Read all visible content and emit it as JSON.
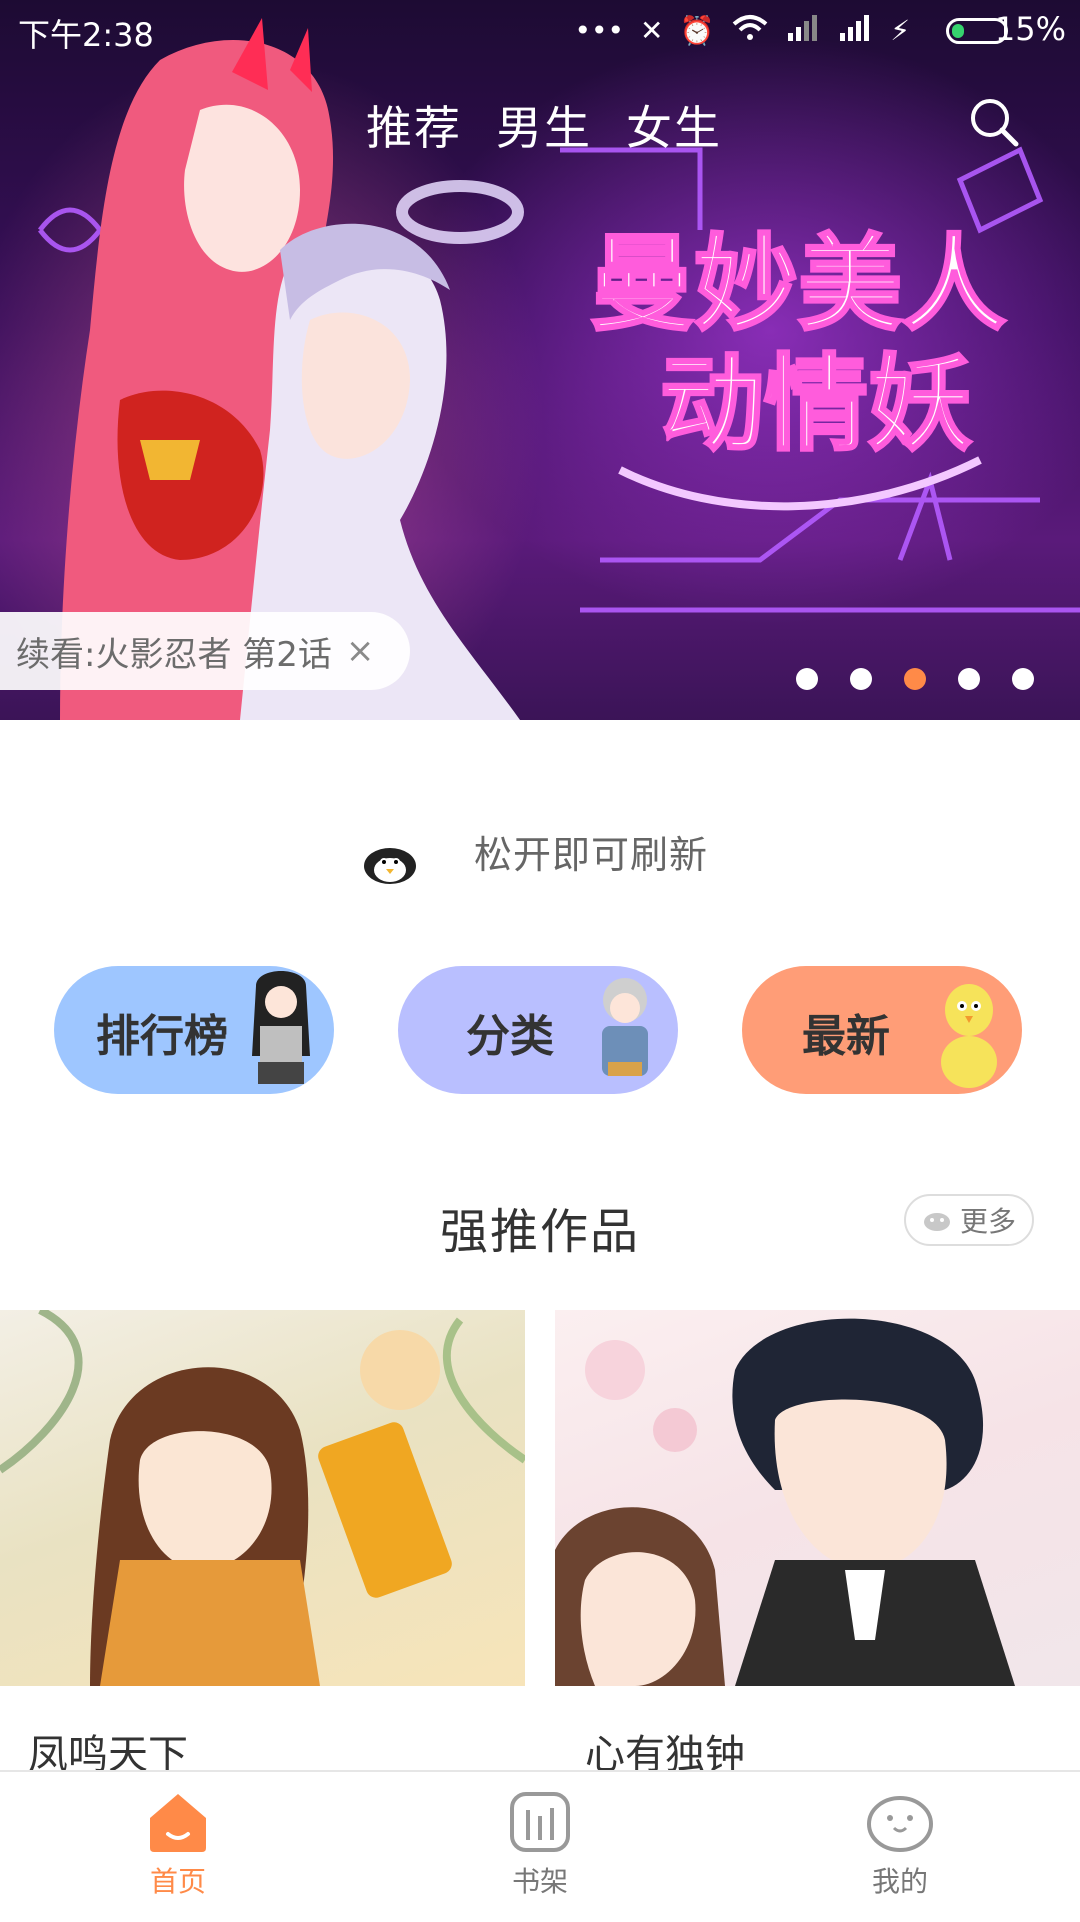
{
  "status_bar": {
    "time": "下午2:38",
    "battery_percent": "15%",
    "battery_level": 0.15,
    "icons": [
      "more-dots-icon",
      "vibrate-off-icon",
      "alarm-icon",
      "wifi-icon",
      "signal-icon",
      "signal-icon",
      "charging-icon",
      "battery-icon"
    ]
  },
  "top_nav": {
    "tabs": [
      {
        "label": "推荐"
      },
      {
        "label": "男生"
      },
      {
        "label": "女生"
      }
    ],
    "search_icon": "search-icon"
  },
  "banner": {
    "title_line1": "曼妙美人",
    "title_line2": "动情妖",
    "continue_label": "续看:火影忍者 第2话",
    "close_glyph": "×",
    "page_count": 5,
    "active_page_index": 2,
    "colors": {
      "active_dot": "#ff8a48",
      "dot": "#ffffff"
    }
  },
  "refresh": {
    "text": "松开即可刷新",
    "icon": "penguin-mascot-icon"
  },
  "categories": [
    {
      "label": "排行榜",
      "color": "#9ec6ff"
    },
    {
      "label": "分类",
      "color": "#b9bfff"
    },
    {
      "label": "最新",
      "color": "#ff9d77"
    }
  ],
  "section": {
    "title": "强推作品",
    "more_label": "更多"
  },
  "cards": [
    {
      "title": "凤鸣天下"
    },
    {
      "title": "心有独钟"
    }
  ],
  "bottom_nav": {
    "items": [
      {
        "label": "首页",
        "icon": "home-icon",
        "active": true
      },
      {
        "label": "书架",
        "icon": "bookshelf-icon",
        "active": false
      },
      {
        "label": "我的",
        "icon": "profile-icon",
        "active": false
      }
    ],
    "active_color": "#ff8a48",
    "inactive_color": "#777777"
  }
}
